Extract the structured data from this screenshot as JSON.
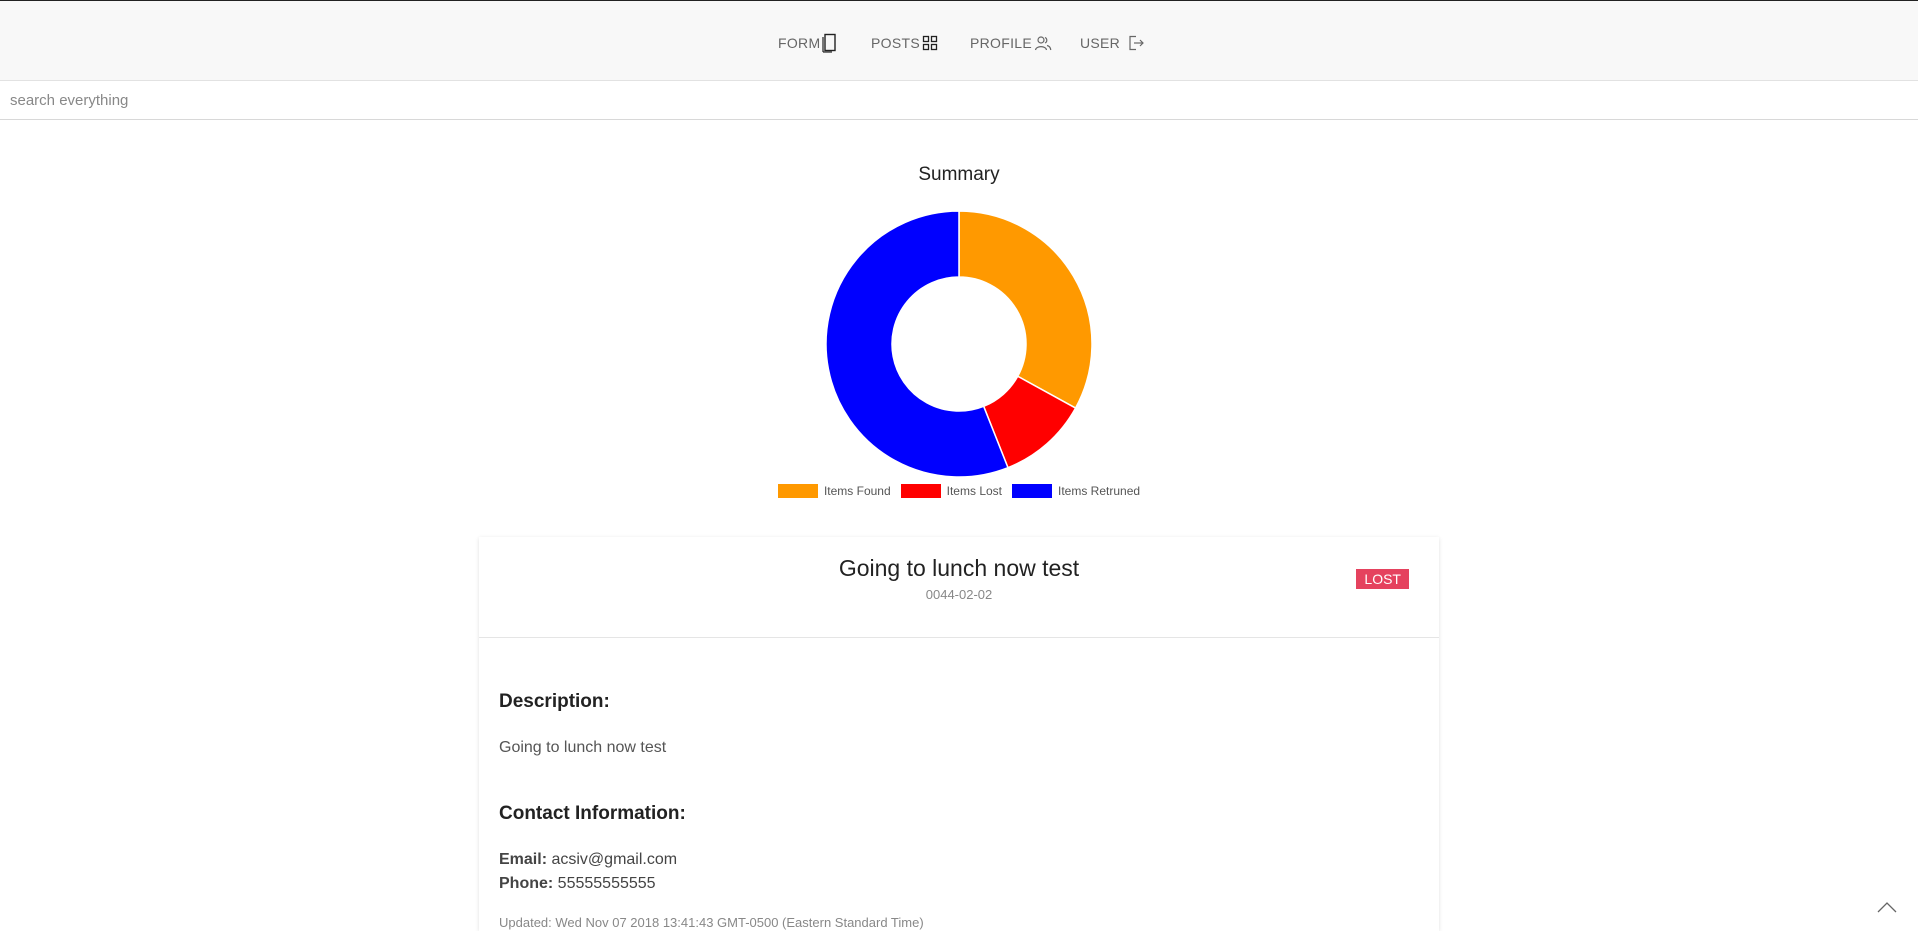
{
  "nav": {
    "items": [
      {
        "label": "FORM",
        "icon": "tablet-icon"
      },
      {
        "label": "POSTS",
        "icon": "grid-icon"
      },
      {
        "label": "PROFILE",
        "icon": "users-icon"
      },
      {
        "label": "USER",
        "icon": "sign-out-icon"
      }
    ]
  },
  "search": {
    "placeholder": "search everything"
  },
  "chart_data": {
    "type": "pie",
    "title": "Summary",
    "categories": [
      "Items Found",
      "Items Lost",
      "Items Retruned"
    ],
    "values": [
      33,
      11,
      56
    ],
    "colors": [
      "#ff9900",
      "#ff0000",
      "#0000ff"
    ],
    "legend": "bottom"
  },
  "card": {
    "title": "Going to lunch now test",
    "date": "0044-02-02",
    "badge": "LOST",
    "badge_color": "#e5425e",
    "description_heading": "Description:",
    "description": "Going to lunch now test",
    "contact_heading": "Contact Information:",
    "email_label": "Email:",
    "email": "acsiv@gmail.com",
    "phone_label": "Phone:",
    "phone": "55555555555",
    "updated": "Updated: Wed Nov 07 2018 13:41:43 GMT-0500 (Eastern Standard Time)"
  }
}
